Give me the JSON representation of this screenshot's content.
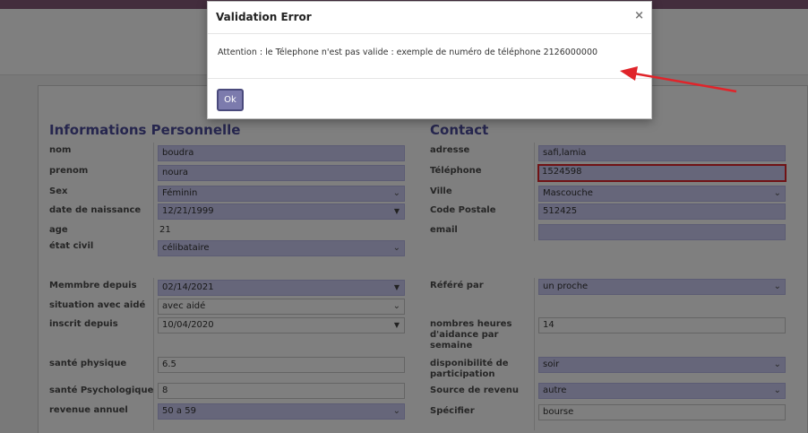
{
  "modal": {
    "title": "Validation Error",
    "close": "×",
    "message": "Attention : le Télephone n'est pas valide : exemple de numéro de téléphone 2126000000",
    "ok": "Ok"
  },
  "personal": {
    "title": "Informations Personnelle",
    "nom_label": "nom",
    "nom": "boudra",
    "prenom_label": "prenom",
    "prenom": "noura",
    "sex_label": "Sex",
    "sex": "Féminin",
    "dob_label": "date de naissance",
    "dob": "12/21/1999",
    "age_label": "age",
    "age": "21",
    "civil_label": "état civil",
    "civil": "célibataire"
  },
  "contact": {
    "title": "Contact",
    "adresse_label": "adresse",
    "adresse": "safi,lamia",
    "tel_label": "Téléphone",
    "tel": "1524598",
    "ville_label": "Ville",
    "ville": "Mascouche",
    "cp_label": "Code Postale",
    "cp": "512425",
    "email_label": "email",
    "email": ""
  },
  "membership": {
    "membre_label": "Memmbre depuis",
    "membre": "02/14/2021",
    "situation_label": "situation avec aidé",
    "situation": "avec aidé",
    "inscrit_label": "inscrit depuis",
    "inscrit": "10/04/2020",
    "sante_phys_label": "santé physique",
    "sante_phys": "6.5",
    "sante_psy_label": "santé Psychologique",
    "sante_psy": "8",
    "revenue_label": "revenue annuel",
    "revenue": "50 a 59"
  },
  "other": {
    "refere_label": "Référé par",
    "refere": "un proche",
    "heures_label": "nombres heures d'aidance par semaine",
    "heures": "14",
    "dispo_label": "disponibilité de participation",
    "dispo": "soir",
    "source_label": "Source de revenu",
    "source": "autre",
    "specifier_label": "Spécifier",
    "specifier": "bourse"
  },
  "icons": {
    "dropdown": "chevron-down-icon",
    "datepicker": "caret-down-icon",
    "close": "close-icon"
  },
  "colors": {
    "accent": "#875a7b",
    "field_bg": "#ccccf5",
    "error": "#e0242a",
    "title": "#4c4c9c"
  }
}
